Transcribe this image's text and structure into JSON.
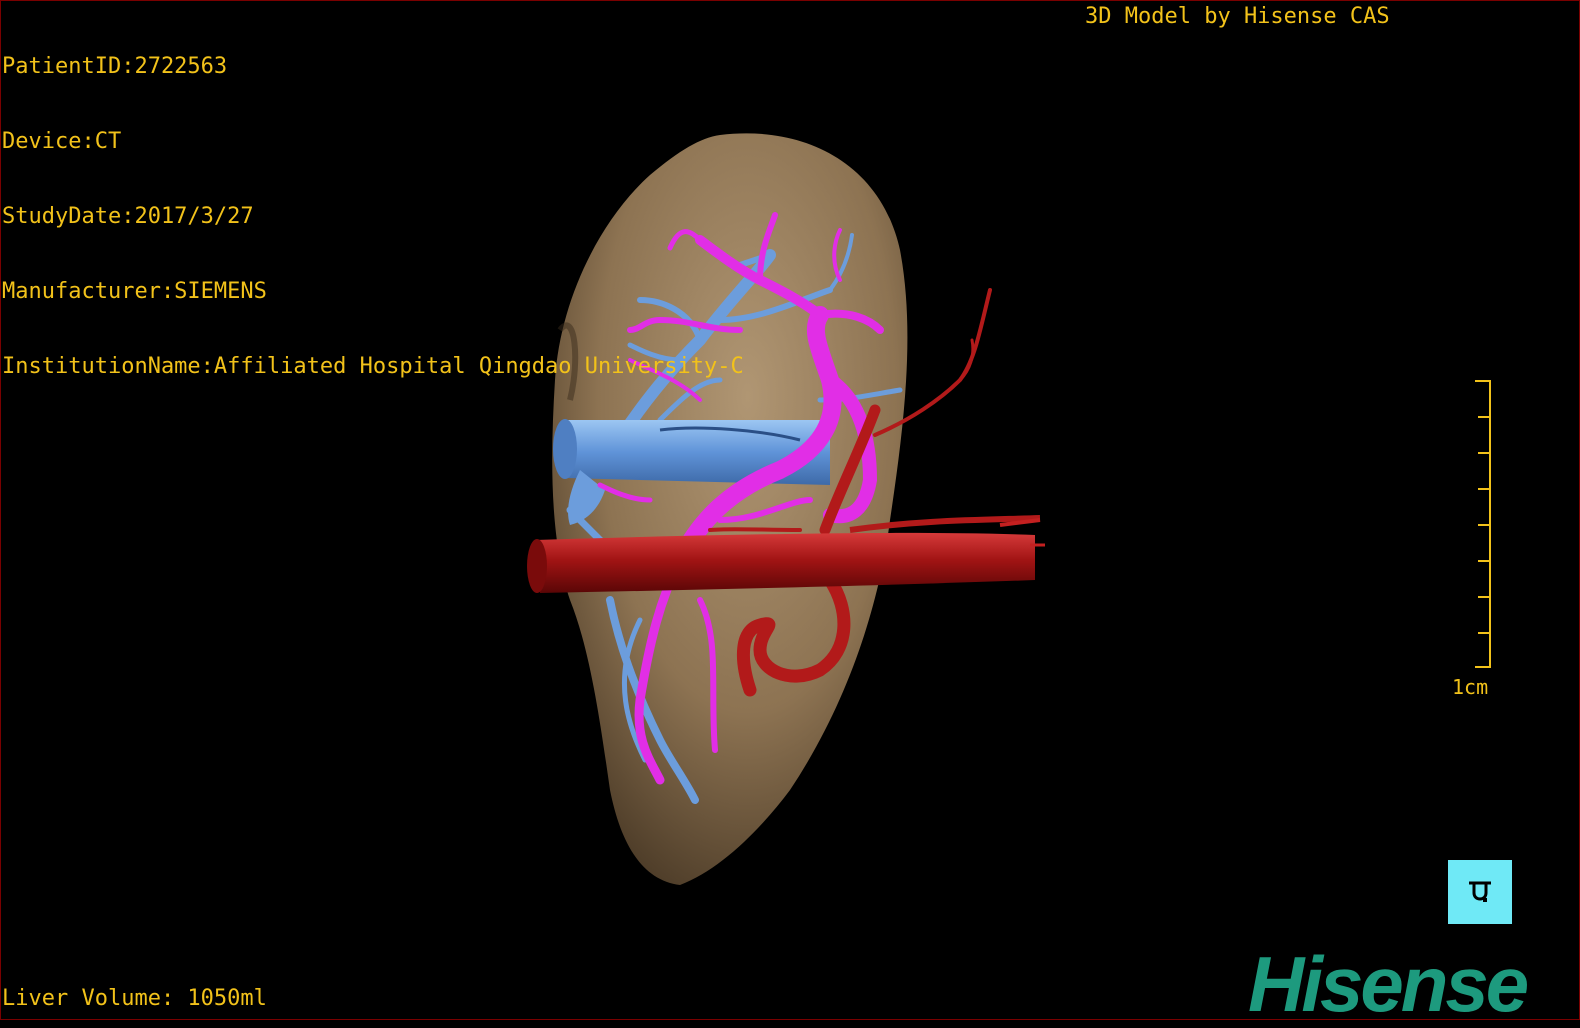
{
  "patient_info": {
    "patient_id": "PatientID:2722563",
    "device": "Device:CT",
    "study_date": "StudyDate:2017/3/27",
    "manufacturer": "Manufacturer:SIEMENS",
    "institution": "InstitutionName:Affiliated Hospital Qingdao University-C"
  },
  "brand_caption": "3D Model by Hisense CAS",
  "liver_volume": "Liver Volume: 1050ml",
  "scale": {
    "label": "1cm",
    "ticks": 9
  },
  "orientation_button": {
    "icon": "orientation-cube-icon",
    "color": "#6fe9f6"
  },
  "logo_text": "Hisense",
  "colors": {
    "text": "#f2c21a",
    "liver": "#8c7353",
    "portal_vein": "#e12ee6",
    "hepatic_vein": "#6c9ddc",
    "artery": "#b21a1a",
    "logo": "#1d9a7e"
  }
}
